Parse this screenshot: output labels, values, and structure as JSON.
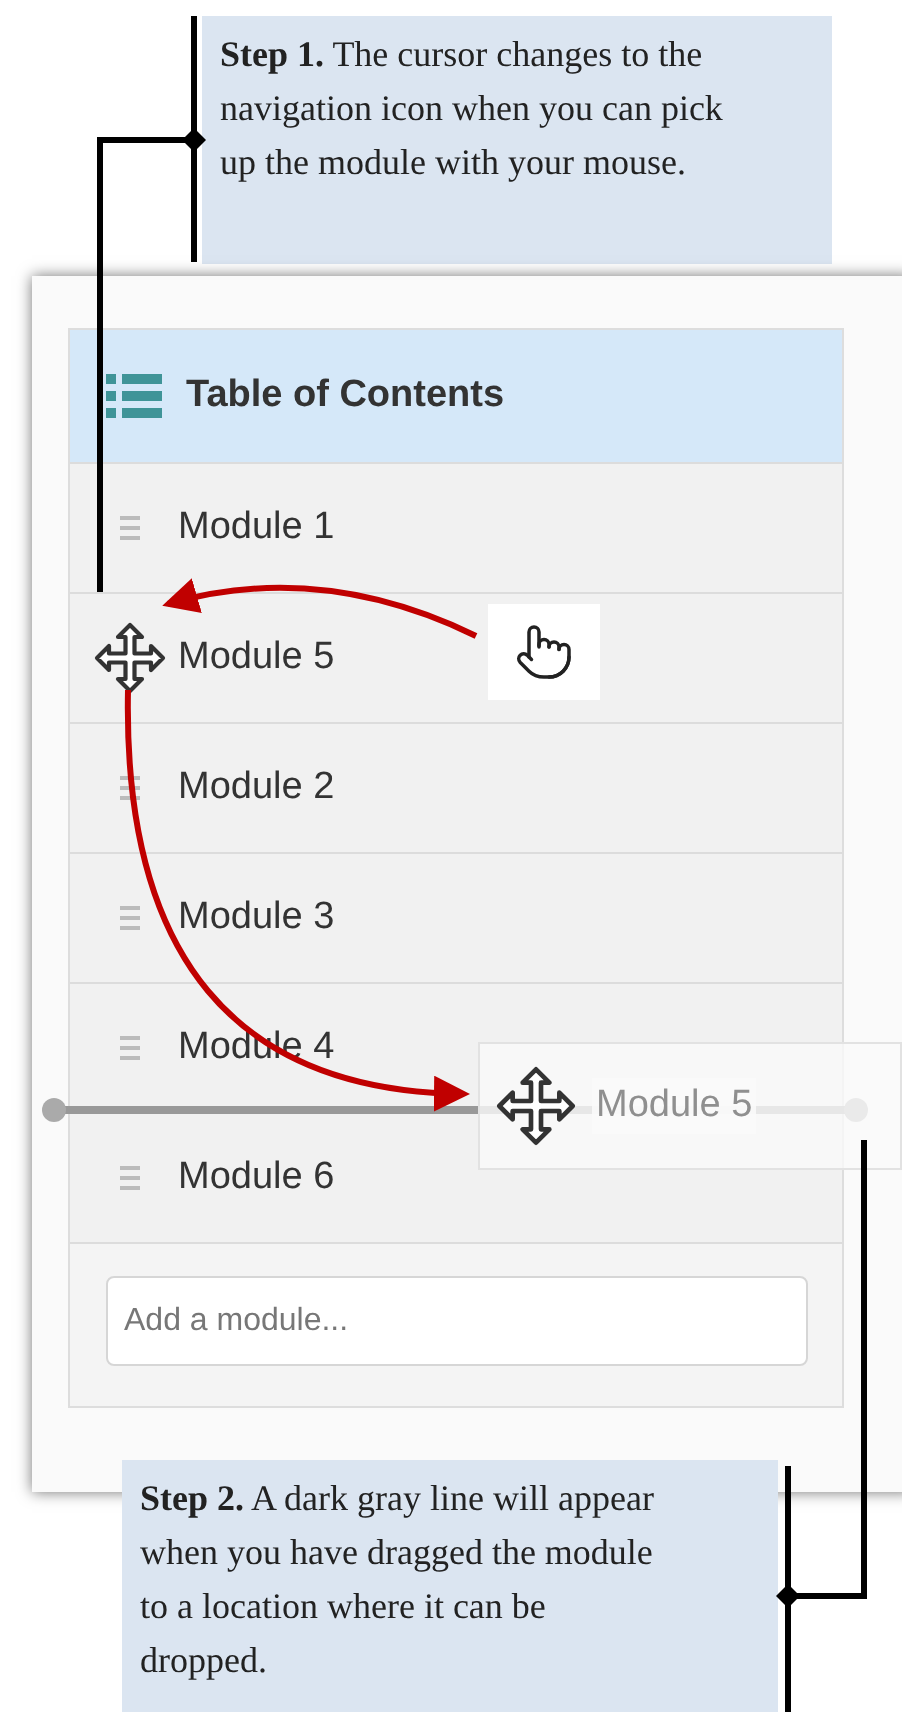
{
  "callouts": [
    {
      "text": "**Step 1.** The cursor changes to the navigation icon when you can pick up the module with your mouse."
    },
    {
      "text": "**Step 2.** A dark gray line will appear when you have dragged the module to a location where it can be dropped."
    }
  ],
  "panel": {
    "title": "Table of Contents",
    "modules": [
      {
        "label": "Module 1",
        "dragging": false
      },
      {
        "label": "Module 5",
        "dragging": true
      },
      {
        "label": "Module 2",
        "dragging": false
      },
      {
        "label": "Module 3",
        "dragging": false
      },
      {
        "label": "Module 4",
        "dragging": false
      },
      {
        "label": "Module 6",
        "dragging": false
      }
    ],
    "drag_preview": {
      "label": "Module 5"
    },
    "add_module": {
      "placeholder": "Add a module..."
    }
  }
}
